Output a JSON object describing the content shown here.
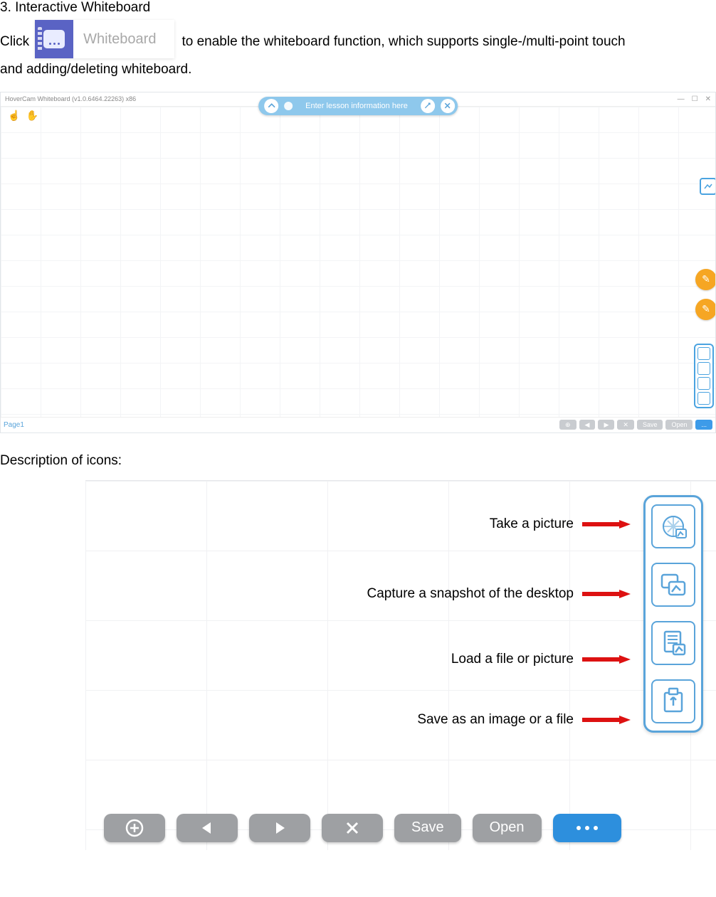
{
  "section": {
    "heading": "3. Interactive Whiteboard",
    "click_word": "Click",
    "whiteboard_button_label": "Whiteboard",
    "intro_after_button": "to enable the whiteboard function, which supports single-/multi-point touch",
    "intro_line2": "and adding/deleting whiteboard.",
    "desc_heading": "Description of icons:"
  },
  "app_screenshot": {
    "window_title": "HoverCam Whiteboard (v1.0.6464.22263) x86",
    "lesson_placeholder": "Enter lesson information here",
    "page_label": "Page1",
    "footer_buttons": {
      "add": "⊕",
      "prev": "◀",
      "next": "▶",
      "close": "✕",
      "save": "Save",
      "open": "Open",
      "more": "..."
    }
  },
  "icon_callouts": {
    "take_picture": "Take a picture",
    "capture_desktop": "Capture a snapshot of the desktop",
    "load_file": "Load a file or picture",
    "save_as": "Save as an image or a file"
  },
  "bottom_buttons": {
    "save": "Save",
    "open": "Open"
  }
}
